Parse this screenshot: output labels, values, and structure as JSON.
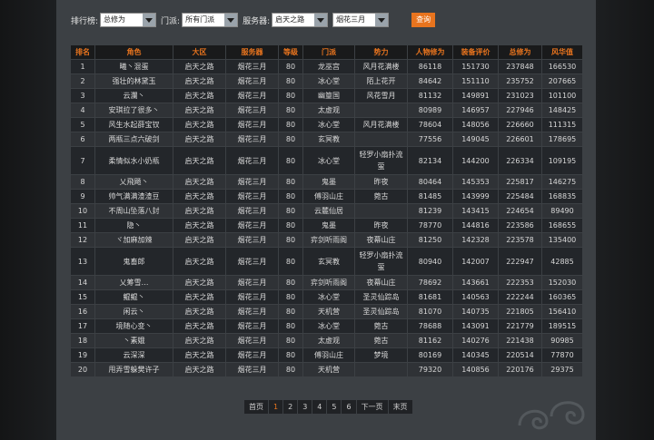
{
  "filters": {
    "rank_label": "排行榜:",
    "rank_value": "总修为",
    "sect_label": "门派:",
    "sect_value": "所有门派",
    "server_label": "服务器:",
    "server_value": "启天之路",
    "subserver_value": "烟花三月",
    "query_label": "查询"
  },
  "table": {
    "headers": [
      "排名",
      "角色",
      "大区",
      "服务器",
      "等级",
      "门派",
      "势力",
      "人物修为",
      "装备评价",
      "总修为",
      "风华值"
    ],
    "rows": [
      [
        "1",
        "曦丶混蛋",
        "启天之路",
        "烟花三月",
        "80",
        "龙巫宫",
        "风月花满楼",
        "86118",
        "151730",
        "237848",
        "166530"
      ],
      [
        "2",
        "强壮的林黛玉",
        "启天之路",
        "烟花三月",
        "80",
        "冰心堂",
        "陌上花开",
        "84642",
        "151110",
        "235752",
        "207665"
      ],
      [
        "3",
        "云瀾丶",
        "启天之路",
        "烟花三月",
        "80",
        "幽篁国",
        "风花雪月",
        "81132",
        "149891",
        "231023",
        "101100"
      ],
      [
        "4",
        "安琪拉了很多丶",
        "启天之路",
        "烟花三月",
        "80",
        "太虚观",
        "",
        "80989",
        "146957",
        "227946",
        "148425"
      ],
      [
        "5",
        "风生水起薛宝钗",
        "启天之路",
        "烟花三月",
        "80",
        "冰心堂",
        "风月花满楼",
        "78604",
        "148056",
        "226660",
        "111315"
      ],
      [
        "6",
        "两瓶三点六破剑",
        "启天之路",
        "烟花三月",
        "80",
        "玄冥教",
        "",
        "77556",
        "149045",
        "226601",
        "178695"
      ],
      [
        "7",
        "柔情似水小奶瓶",
        "启天之路",
        "烟花三月",
        "80",
        "冰心堂",
        "轻罗小扇扑流萤",
        "82134",
        "144200",
        "226334",
        "109195"
      ],
      [
        "8",
        "乂飛飏丶",
        "启天之路",
        "烟花三月",
        "80",
        "鬼墨",
        "昨夜",
        "80464",
        "145353",
        "225817",
        "146275"
      ],
      [
        "9",
        "帅气满满渣渣豆",
        "启天之路",
        "烟花三月",
        "80",
        "傅羽山庄",
        "菀古",
        "81485",
        "143999",
        "225484",
        "168835"
      ],
      [
        "10",
        "不周山坠落八封",
        "启天之路",
        "烟花三月",
        "80",
        "云麓仙居",
        "",
        "81239",
        "143415",
        "224654",
        "89490"
      ],
      [
        "11",
        "隐丶",
        "启天之路",
        "烟花三月",
        "80",
        "鬼墨",
        "昨夜",
        "78770",
        "144816",
        "223586",
        "168655"
      ],
      [
        "12",
        "ヾ加麻加辣",
        "启天之路",
        "烟花三月",
        "80",
        "弈剑听雨阁",
        "夜幕山庄",
        "81250",
        "142328",
        "223578",
        "135400"
      ],
      [
        "13",
        "鬼畜郎",
        "启天之路",
        "烟花三月",
        "80",
        "玄冥教",
        "轻罗小扇扑流萤",
        "80940",
        "142007",
        "222947",
        "42885"
      ],
      [
        "14",
        "乂筹雪…",
        "启天之路",
        "烟花三月",
        "80",
        "弈剑听雨阁",
        "夜幕山庄",
        "78692",
        "143661",
        "222353",
        "152030"
      ],
      [
        "15",
        "鲲鲲丶",
        "启天之路",
        "烟花三月",
        "80",
        "冰心堂",
        "圣灵仙踪岛",
        "81681",
        "140563",
        "222244",
        "160365"
      ],
      [
        "16",
        "闲云丶",
        "启天之路",
        "烟花三月",
        "80",
        "天机营",
        "圣灵仙踪岛",
        "81070",
        "140735",
        "221805",
        "156410"
      ],
      [
        "17",
        "境随心变丶",
        "启天之路",
        "烟花三月",
        "80",
        "冰心堂",
        "菀古",
        "78688",
        "143091",
        "221779",
        "189515"
      ],
      [
        "18",
        "丶素娥",
        "启天之路",
        "烟花三月",
        "80",
        "太虚观",
        "菀古",
        "81162",
        "140276",
        "221438",
        "90985"
      ],
      [
        "19",
        "云深深",
        "启天之路",
        "烟花三月",
        "80",
        "傅羽山庄",
        "梦境",
        "80169",
        "140345",
        "220514",
        "77870"
      ],
      [
        "20",
        "甩弄雪躲樊许子",
        "启天之路",
        "烟花三月",
        "80",
        "天机营",
        "",
        "79320",
        "140856",
        "220176",
        "29375"
      ]
    ]
  },
  "pager": {
    "first": "首页",
    "pages": [
      "1",
      "2",
      "3",
      "4",
      "5",
      "6"
    ],
    "active_page": "1",
    "next": "下一页",
    "last": "末页"
  },
  "colors": {
    "accent": "#e8741e",
    "panel": "#3c4044",
    "header_bg": "#191a1b"
  }
}
